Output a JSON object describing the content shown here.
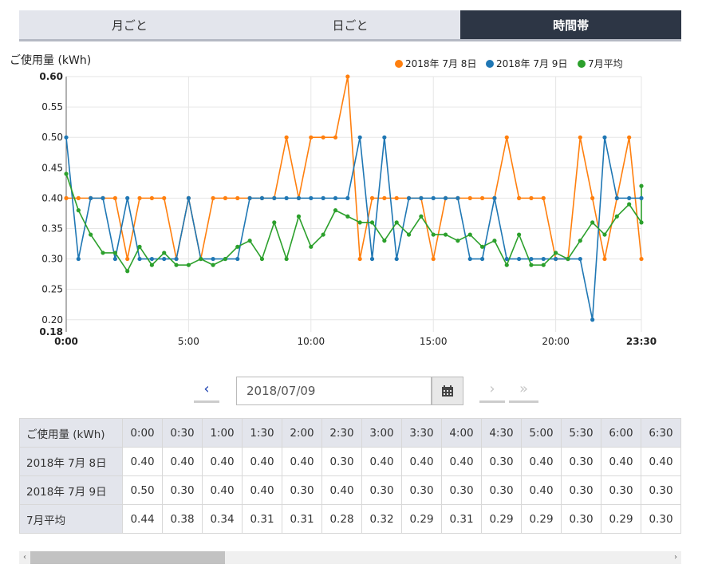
{
  "tabs": [
    {
      "label": "月ごと",
      "active": false
    },
    {
      "label": "日ごと",
      "active": false
    },
    {
      "label": "時間帯",
      "active": true
    }
  ],
  "date_nav": {
    "prev_icon": "chevron-left-icon",
    "date_value": "2018/07/09",
    "calendar_icon": "calendar-icon",
    "next_icon": "chevron-right-icon",
    "last_icon": "double-chevron-right-icon"
  },
  "colors": {
    "series1": "#ff7f0e",
    "series2": "#1f77b4",
    "series3": "#2ca02c"
  },
  "chart_data": {
    "type": "line",
    "ylabel": "ご使用量 (kWh)",
    "ylim": [
      0.18,
      0.6
    ],
    "yticks": [
      "0.20",
      "0.25",
      "0.30",
      "0.35",
      "0.40",
      "0.45",
      "0.50",
      "0.55",
      "0.60"
    ],
    "ymin_label": "0.18",
    "xticks": [
      "0:00",
      "5:00",
      "10:00",
      "15:00",
      "20:00",
      "23:30"
    ],
    "legend_position": "top-right",
    "x_step_minutes": 30,
    "grid": true,
    "series": [
      {
        "name": "2018年 7月 8日",
        "values": [
          0.4,
          0.4,
          0.4,
          0.4,
          0.4,
          0.3,
          0.4,
          0.4,
          0.4,
          0.3,
          0.4,
          0.3,
          0.4,
          0.4,
          0.4,
          0.4,
          0.4,
          0.4,
          0.5,
          0.4,
          0.5,
          0.5,
          0.5,
          0.6,
          0.3,
          0.4,
          0.4,
          0.4,
          0.4,
          0.4,
          0.3,
          0.4,
          0.4,
          0.4,
          0.4,
          0.4,
          0.5,
          0.4,
          0.4,
          0.4,
          0.3,
          0.3,
          0.5,
          0.4,
          0.3,
          0.4,
          0.5,
          0.3
        ]
      },
      {
        "name": "2018年 7月 9日",
        "values": [
          0.5,
          0.3,
          0.4,
          0.4,
          0.3,
          0.4,
          0.3,
          0.3,
          0.3,
          0.3,
          0.4,
          0.3,
          0.3,
          0.3,
          0.3,
          0.4,
          0.4,
          0.4,
          0.4,
          0.4,
          0.4,
          0.4,
          0.4,
          0.4,
          0.5,
          0.3,
          0.5,
          0.3,
          0.4,
          0.4,
          0.4,
          0.4,
          0.4,
          0.3,
          0.3,
          0.4,
          0.3,
          0.3,
          0.3,
          0.3,
          0.3,
          0.3,
          0.3,
          0.2,
          0.5,
          0.4,
          0.4,
          0.4
        ]
      },
      {
        "name": "7月平均",
        "values": [
          0.44,
          0.38,
          0.34,
          0.31,
          0.31,
          0.28,
          0.32,
          0.29,
          0.31,
          0.29,
          0.29,
          0.3,
          0.29,
          0.3,
          0.32,
          0.33,
          0.3,
          0.36,
          0.3,
          0.37,
          0.32,
          0.34,
          0.38,
          0.37,
          0.36,
          0.36,
          0.33,
          0.36,
          0.34,
          0.37,
          0.34,
          0.34,
          0.33,
          0.34,
          0.32,
          0.33,
          0.29,
          0.34,
          0.29,
          0.29,
          0.31,
          0.3,
          0.33,
          0.36,
          0.34,
          0.37,
          0.39,
          0.36,
          0.42
        ]
      }
    ]
  },
  "table": {
    "header_label": "ご使用量 (kWh)",
    "columns": [
      "0:00",
      "0:30",
      "1:00",
      "1:30",
      "2:00",
      "2:30",
      "3:00",
      "3:30",
      "4:00",
      "4:30",
      "5:00",
      "5:30",
      "6:00",
      "6:30"
    ],
    "rows": [
      {
        "label": "2018年 7月 8日",
        "values": [
          "0.40",
          "0.40",
          "0.40",
          "0.40",
          "0.40",
          "0.30",
          "0.40",
          "0.40",
          "0.40",
          "0.30",
          "0.40",
          "0.30",
          "0.40",
          "0.40"
        ]
      },
      {
        "label": "2018年 7月 9日",
        "values": [
          "0.50",
          "0.30",
          "0.40",
          "0.40",
          "0.30",
          "0.40",
          "0.30",
          "0.30",
          "0.30",
          "0.30",
          "0.40",
          "0.30",
          "0.30",
          "0.30"
        ]
      },
      {
        "label": "7月平均",
        "values": [
          "0.44",
          "0.38",
          "0.34",
          "0.31",
          "0.31",
          "0.28",
          "0.32",
          "0.29",
          "0.31",
          "0.29",
          "0.29",
          "0.30",
          "0.29",
          "0.30"
        ]
      }
    ]
  }
}
